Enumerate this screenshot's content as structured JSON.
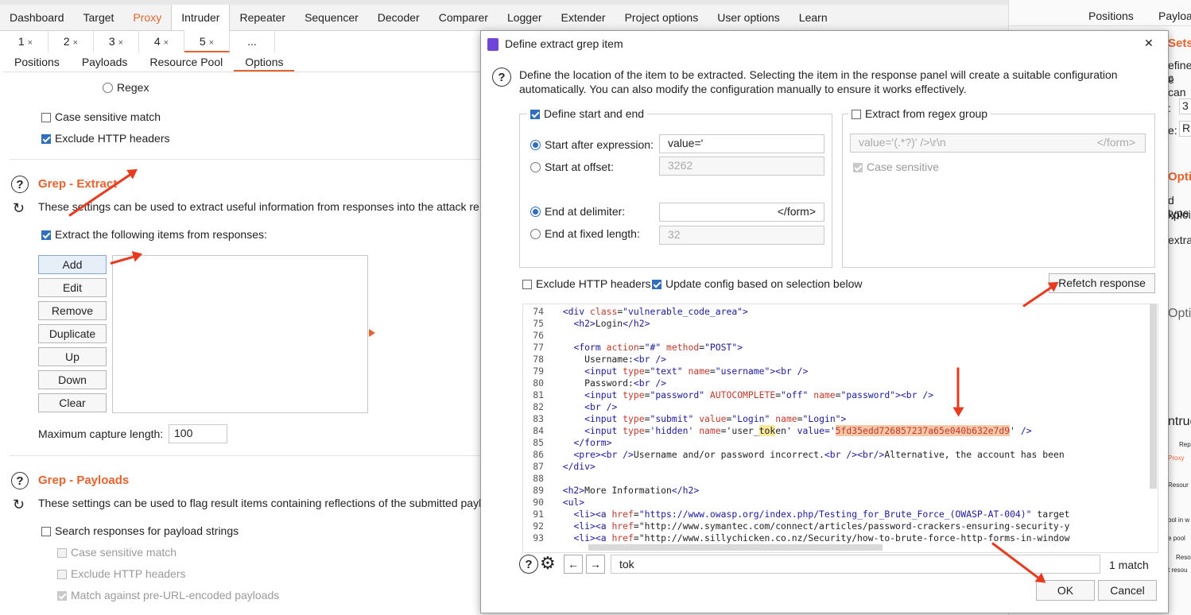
{
  "menu": [
    "Dashboard",
    "Target",
    "Proxy",
    "Intruder",
    "Repeater",
    "Sequencer",
    "Decoder",
    "Comparer",
    "Logger",
    "Extender",
    "Project options",
    "User options",
    "Learn"
  ],
  "attack_tabs": [
    {
      "label": "1",
      "close": "×"
    },
    {
      "label": "2",
      "close": "×"
    },
    {
      "label": "3",
      "close": "×"
    },
    {
      "label": "4",
      "close": "×"
    },
    {
      "label": "5",
      "close": "×"
    },
    {
      "label": "...",
      "close": ""
    }
  ],
  "option_tabs": [
    "Positions",
    "Payloads",
    "Resource Pool",
    "Options"
  ],
  "left": {
    "regex_label": "Regex",
    "case_sensitive": "Case sensitive match",
    "exclude_http": "Exclude HTTP headers",
    "grep_extract": {
      "title": "Grep - Extract",
      "desc": "These settings can be used to extract useful information from responses into the attack re",
      "extract_label": "Extract the following items from responses:",
      "buttons": [
        "Add",
        "Edit",
        "Remove",
        "Duplicate",
        "Up",
        "Down",
        "Clear"
      ],
      "max_capture_label": "Maximum capture length:",
      "max_capture_value": "100"
    },
    "grep_payloads": {
      "title": "Grep - Payloads",
      "desc": "These settings can be used to flag result items containing reflections of the submitted payl",
      "search_label": "Search responses for payload strings",
      "case_label": "Case sensitive match",
      "exclude_label": "Exclude HTTP headers",
      "match_label": "Match against pre-URL-encoded payloads"
    }
  },
  "right_peek": {
    "tab1": "Positions",
    "tab2": "Payloa",
    "sets": "Sets",
    "l1": "efine c",
    "l2": "e can",
    "l3": ":",
    "l4": "e:",
    "v1": "3",
    "v2": "R",
    "opt": "Optic",
    "t1": "d type",
    "t2": "xploit",
    "t3": "extra",
    "opt2": "Opti",
    "intr": "ntrude",
    "small1": "Rep",
    "small2": "Proxy",
    "small3": "Resour",
    "small4": "ool in w",
    "small5": "e pool",
    "small6": "Resou",
    "small7": "t resou"
  },
  "dialog": {
    "title": "Define extract grep item",
    "close": "✕",
    "description": "Define the location of the item to be extracted. Selecting the item in the response panel will create a suitable configuration automatically. You can also modify the configuration manually to ensure it works effectively.",
    "define_start_end": "Define start and end",
    "start_after_label": "Start after expression:",
    "start_after_value": "value='",
    "start_offset_label": "Start at offset:",
    "start_offset_value": "3262",
    "end_delim_label": "End at delimiter:",
    "end_delim_value": "</form>",
    "end_fixed_label": "End at fixed length:",
    "end_fixed_value": "32",
    "regex_group_label": "Extract from regex group",
    "regex_value": "value='(.*?)' />\\r\\n",
    "regex_value_end": "</form>",
    "regex_case": "Case sensitive",
    "exclude_http": "Exclude HTTP headers",
    "update_config": "Update config based on selection below",
    "refetch": "Refetch response",
    "code_lines": [
      {
        "n": "74",
        "t": "  <div class=\"vulnerable_code_area\">"
      },
      {
        "n": "75",
        "t": "    <h2>Login</h2>"
      },
      {
        "n": "76",
        "t": ""
      },
      {
        "n": "77",
        "t": "    <form action=\"#\" method=\"POST\">"
      },
      {
        "n": "78",
        "t": "      Username:<br />"
      },
      {
        "n": "79",
        "t": "      <input type=\"text\" name=\"username\"><br />"
      },
      {
        "n": "80",
        "t": "      Password:<br />"
      },
      {
        "n": "81",
        "t": "      <input type=\"password\" AUTOCOMPLETE=\"off\" name=\"password\"><br />"
      },
      {
        "n": "82",
        "t": "      <br />"
      },
      {
        "n": "83",
        "t": "      <input type=\"submit\" value=\"Login\" name=\"Login\">"
      },
      {
        "n": "84",
        "pre": "      <input type='hidden' name='user_",
        "mid": "tok",
        "post": "en' value='",
        "token": "5fd35edd726857237a65e040b632e7d9",
        "tail": "' />"
      },
      {
        "n": "85",
        "t": "    </form>"
      },
      {
        "n": "86",
        "t": "    <pre><br />Username and/or password incorrect.<br /><br/>Alternative, the account has been"
      },
      {
        "n": "87",
        "t": "  </div>"
      },
      {
        "n": "88",
        "t": ""
      },
      {
        "n": "89",
        "t": "  <h2>More Information</h2>"
      },
      {
        "n": "90",
        "t": "  <ul>"
      },
      {
        "n": "91",
        "t": "    <li><a href=\"https://www.owasp.org/index.php/Testing_for_Brute_Force_(OWASP-AT-004)\" target"
      },
      {
        "n": "92",
        "t": "    <li><a href=\"http://www.symantec.com/connect/articles/password-crackers-ensuring-security-y"
      },
      {
        "n": "93",
        "t": "    <li><a href=\"http://www.sillychicken.co.nz/Security/how-to-brute-force-http-forms-in-window"
      }
    ],
    "search_value": "tok",
    "match_count": "1 match",
    "ok": "OK",
    "cancel": "Cancel"
  }
}
